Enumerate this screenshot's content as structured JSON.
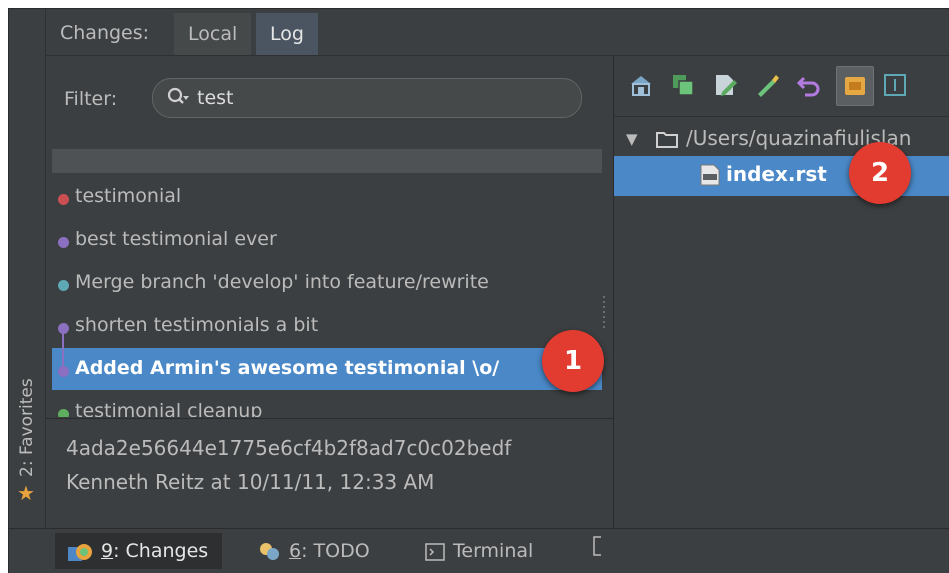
{
  "tabs": {
    "title": "Changes:",
    "items": [
      {
        "label": "Local"
      },
      {
        "label": "Log"
      }
    ]
  },
  "filter": {
    "label": "Filter:",
    "value": "test"
  },
  "commits": [
    {
      "message": "testimonial",
      "color": "#c94f53"
    },
    {
      "message": "best testimonial ever",
      "color": "#8b6fc0"
    },
    {
      "message": "Merge branch 'develop' into feature/rewrite",
      "color": "#5fa8b5"
    },
    {
      "message": "shorten testimonials a bit",
      "color": "#8b6fc0"
    },
    {
      "message": "Added Armin's awesome testimonial \\o/",
      "color": "#8b6fc0"
    },
    {
      "message": "testimonial cleanup",
      "color": "#5fae5f"
    }
  ],
  "details": {
    "hash": "4ada2e56644e1775e6cf4b2f8ad7c0c02bedf",
    "author_line": "Kenneth Reitz at 10/11/11, 12:33 AM"
  },
  "tree": {
    "root_path": "/Users/quazinafiulislan",
    "file": "index.rst"
  },
  "callouts": [
    "1",
    "2"
  ],
  "sidebar": {
    "favorites_label": "2: Favorites"
  },
  "bottom_tabs": {
    "changes": {
      "mnemonic": "9",
      "label": ": Changes"
    },
    "todo": {
      "mnemonic": "6",
      "label": ": TODO"
    },
    "terminal": {
      "label": "Terminal"
    }
  },
  "colors": {
    "selection": "#4a88c7",
    "callout": "#e23b30",
    "favorite_star": "#e8a33c"
  }
}
